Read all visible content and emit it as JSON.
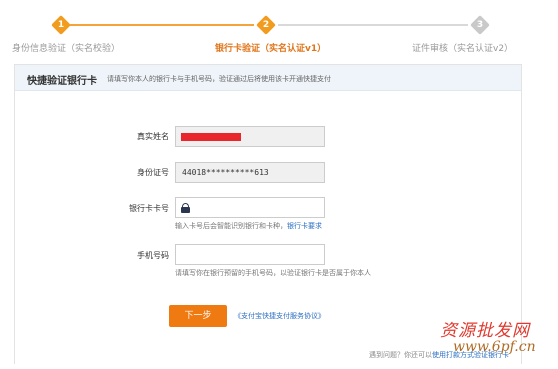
{
  "steps": [
    {
      "num": "1",
      "label": "身份信息验证（实名校验）",
      "state": "done"
    },
    {
      "num": "2",
      "label": "银行卡验证（实名认证v1）",
      "state": "current"
    },
    {
      "num": "3",
      "label": "证件审核（实名认证v2）",
      "state": "pending"
    }
  ],
  "colors": {
    "accent": "#f29c1f",
    "button": "#f07a12",
    "link": "#2b6fc2",
    "masked_name": "#e8262b"
  },
  "card": {
    "title": "快捷验证银行卡",
    "hint": "请填写你本人的银行卡与手机号码，验证通过后将使用该卡开通快捷支付"
  },
  "form": {
    "real_name_label": "真实姓名",
    "id_label": "身份证号",
    "id_value": "44018**********613",
    "card_label": "银行卡卡号",
    "card_help": "输入卡号后会智能识别银行和卡种，",
    "card_help_link": "银行卡要求",
    "phone_label": "手机号码",
    "phone_help": "请填写你在银行预留的手机号码，以验证银行卡是否属于你本人"
  },
  "actions": {
    "next_label": "下一步",
    "agreement_link": "《支付宝快捷支付服务协议》"
  },
  "footer": {
    "text": "遇到问题？你还可以",
    "link": "使用打款方式验证银行卡"
  },
  "watermark": {
    "text": "资源批发网",
    "url": "www.6pf.cn"
  }
}
